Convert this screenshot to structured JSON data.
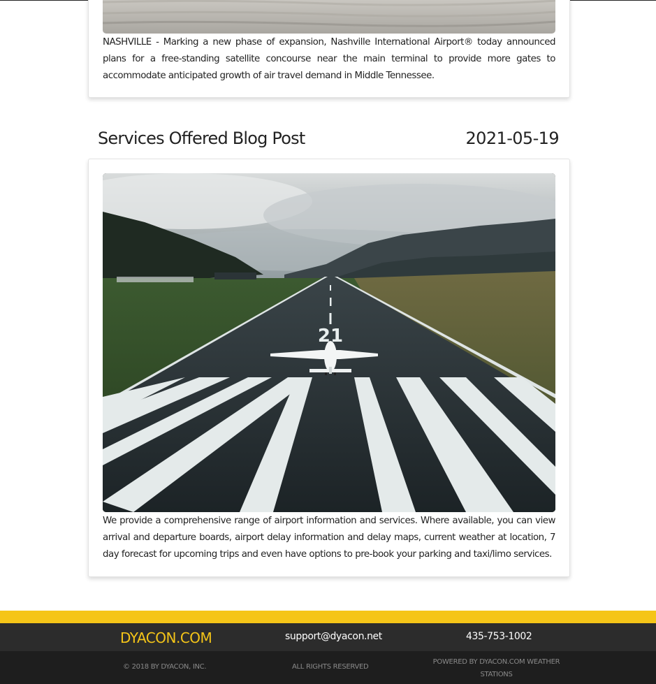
{
  "posts": [
    {
      "body": "NASHVILLE - Marking a new phase of expansion, Nashville International Airport® today announced plans for a free-standing satellite concourse near the main terminal to provide more gates to accommodate anticipated growth of air travel demand in Middle Tennessee."
    },
    {
      "title": "Services Offered Blog Post",
      "date": "2021-05-19",
      "image_alt": "Small plane on runway",
      "runway_number": "21",
      "body": "We provide a comprehensive range of airport information and services. Where available, you can view arrival and departure boards, airport delay information and delay maps, current weather at location, 7 day forecast for upcoming trips and even have options to pre-book your parking and taxi/limo services."
    }
  ],
  "footer": {
    "brand": "DYACON.COM",
    "email": "support@dyacon.net",
    "phone": "435-753-1002",
    "copyright": "© 2018 BY DYACON, INC.",
    "rights": "ALL RIGHTS RESERVED",
    "powered": "POWERED BY DYACON.COM WEATHER STATIONS"
  },
  "colors": {
    "accent": "#f5c518",
    "footer_top": "#2c2c2c",
    "footer_bottom": "#1e1e1e"
  }
}
